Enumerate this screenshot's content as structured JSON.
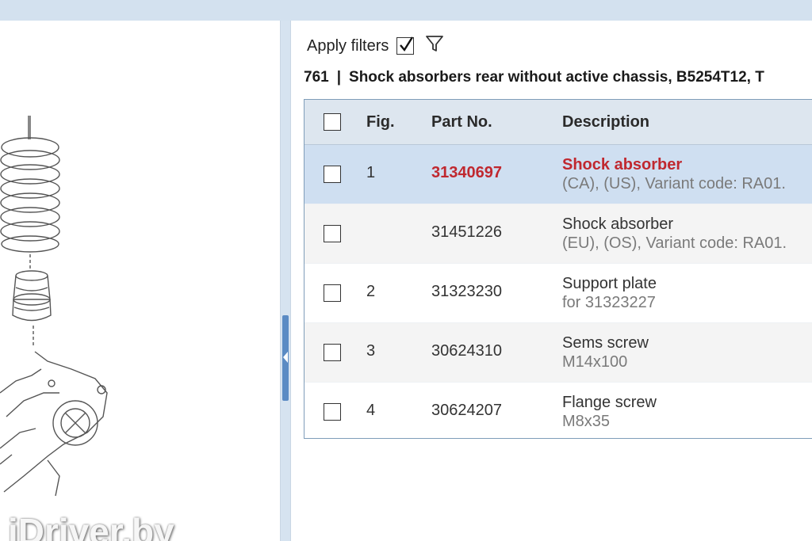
{
  "filters": {
    "label": "Apply filters",
    "checked": true,
    "icon": "funnel-icon"
  },
  "group": {
    "number": "761",
    "separator": "|",
    "title": "Shock absorbers rear without active chassis, B5254T12, T"
  },
  "table": {
    "headers": {
      "fig": "Fig.",
      "part_no": "Part No.",
      "description": "Description"
    },
    "rows": [
      {
        "fig": "1",
        "part_no": "31340697",
        "description": "Shock absorber",
        "detail": "(CA), (US), Variant code: RA01.",
        "selected": true
      },
      {
        "fig": "",
        "part_no": "31451226",
        "description": "Shock absorber",
        "detail": "(EU), (OS), Variant code: RA01.",
        "selected": false
      },
      {
        "fig": "2",
        "part_no": "31323230",
        "description": "Support plate",
        "detail": "for 31323227",
        "selected": false
      },
      {
        "fig": "3",
        "part_no": "30624310",
        "description": "Sems screw",
        "detail": "M14x100",
        "selected": false
      },
      {
        "fig": "4",
        "part_no": "30624207",
        "description": "Flange screw",
        "detail": "M8x35",
        "selected": false
      }
    ]
  },
  "watermark": "iDriver.by",
  "colors": {
    "highlight_red": "#c0282f",
    "selected_row": "#cfdff1",
    "header_bg": "#dde6ef",
    "splitter": "#5b8bc4"
  }
}
